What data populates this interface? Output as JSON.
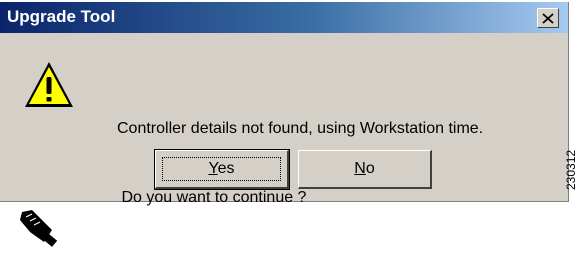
{
  "window": {
    "title": "Upgrade Tool",
    "close_icon": "close-x-icon"
  },
  "message": {
    "line1": "Controller details not found, using Workstation time.",
    "line2": " Do you want to continue ?",
    "icon": "warning-triangle-icon"
  },
  "buttons": {
    "yes": {
      "mnemonic": "Y",
      "rest": "es"
    },
    "no": {
      "mnemonic": "N",
      "rest": "o"
    }
  },
  "figure_id": "230312",
  "footer_icon": "cable-connector-icon",
  "colors": {
    "titlebar_start": "#0a246a",
    "titlebar_end": "#a6caf0",
    "dialog_face": "#d4d0c8",
    "warning_fill": "#ffff00"
  }
}
